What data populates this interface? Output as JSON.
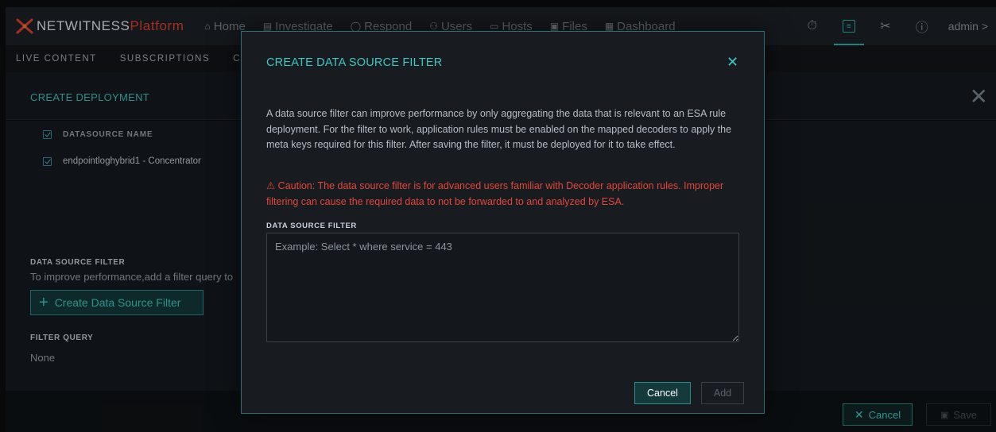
{
  "brand": {
    "name": "NETWITNESS",
    "product": "Platform"
  },
  "nav": [
    {
      "icon": "⌂",
      "icon_name": "home-icon",
      "label": "Home"
    },
    {
      "icon": "▤",
      "icon_name": "investigate-icon",
      "label": "Investigate"
    },
    {
      "icon": "◯",
      "icon_name": "shield-icon",
      "label": "Respond"
    },
    {
      "icon": "⚇",
      "icon_name": "users-icon",
      "label": "Users"
    },
    {
      "icon": "▭",
      "icon_name": "hosts-icon",
      "label": "Hosts"
    },
    {
      "icon": "▣",
      "icon_name": "files-icon",
      "label": "Files"
    },
    {
      "icon": "▦",
      "icon_name": "dashboard-icon",
      "label": "Dashboard"
    }
  ],
  "tools": {
    "user_label": "admin >"
  },
  "subnav": [
    "LIVE CONTENT",
    "SUBSCRIPTIONS",
    "C"
  ],
  "panel": {
    "title": "CREATE DEPLOYMENT"
  },
  "datasources": {
    "header": "DATASOURCE NAME",
    "rows": [
      "endpointloghybrid1 - Concentrator"
    ]
  },
  "filter_section": {
    "title": "DATA SOURCE FILTER",
    "help": "To improve performance,add a filter query to",
    "create_button": "Create Data Source Filter",
    "query_title": "FILTER QUERY",
    "query_value": "None"
  },
  "footer": {
    "cancel": "Cancel",
    "save": "Save"
  },
  "modal": {
    "title": "CREATE DATA SOURCE FILTER",
    "description": "A data source filter can improve performance by only aggregating the data that is relevant to an ESA rule deployment. For the filter to work, application rules must be enabled on the mapped decoders to apply the meta keys required for this filter. After saving the filter, it must be deployed for it to take effect.",
    "caution": "⚠ Caution: The data source filter is for advanced users familiar with Decoder application rules. Improper filtering can cause the required data to not be forwarded to and analyzed by ESA.",
    "field_label": "DATA SOURCE FILTER",
    "placeholder": "Example: Select * where service = 443",
    "value": "",
    "cancel": "Cancel",
    "add": "Add"
  },
  "colors": {
    "accent": "#3cc7c2",
    "warning": "#e0473b",
    "brand_red": "#e2442f"
  }
}
